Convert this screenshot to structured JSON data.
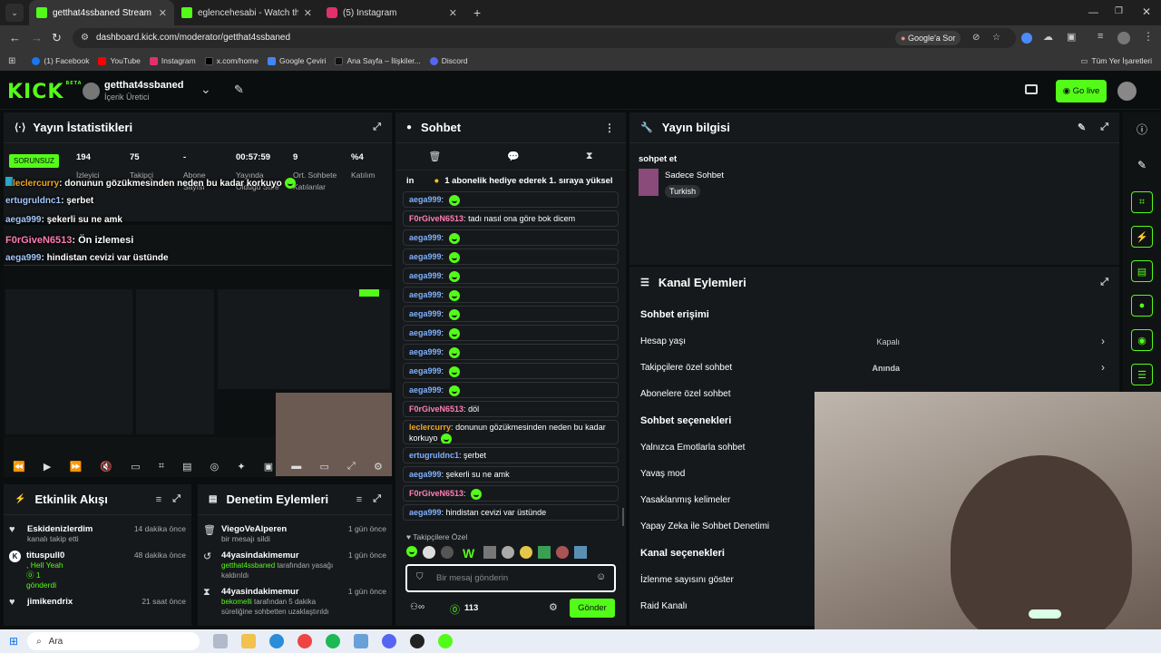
{
  "browser": {
    "tabs": [
      {
        "title": "getthat4ssbaned Stream - Kick",
        "color": "#53fc18"
      },
      {
        "title": "eglencehesabi - Watch the VOD",
        "color": "#53fc18"
      },
      {
        "title": "(5) Instagram",
        "color": "#e1306c"
      }
    ],
    "url": "dashboard.kick.com/moderator/getthat4ssbaned",
    "google_sor": "Google'a Sor",
    "bookmarks": [
      {
        "label": "(1) Facebook",
        "color": "#1877f2"
      },
      {
        "label": "YouTube",
        "color": "#ff0000"
      },
      {
        "label": "Instagram",
        "color": "#e1306c"
      },
      {
        "label": "x.com/home",
        "color": "#000000"
      },
      {
        "label": "Google Çeviri",
        "color": "#4285f4"
      },
      {
        "label": "Ana Sayfa – İlişkiler...",
        "color": "#111111"
      },
      {
        "label": "Discord",
        "color": "#5865f2"
      }
    ],
    "all_bookmarks": "Tüm Yer İşaretleri"
  },
  "header": {
    "logo": "KICK",
    "logo_sup": "BETA",
    "channel_name": "getthat4ssbaned",
    "channel_role": "İçerik Üretici",
    "go_live": "Go live",
    "accent": "#53fc18"
  },
  "stats": {
    "title": "Yayın İstatistikleri",
    "status_badge": "SORUNSUZ",
    "items": [
      {
        "value": "194",
        "label": "İzleyici"
      },
      {
        "value": "75",
        "label": "Takipçi"
      },
      {
        "value": "-",
        "label": "Abone Sayısı"
      },
      {
        "value": "00:57:59",
        "label": "Yayında Olduğu Süre"
      },
      {
        "value": "9",
        "label": "Ort. Sohbete Katılanlar"
      },
      {
        "value": "%4",
        "label": "Katılım"
      }
    ]
  },
  "overlay_chat": [
    {
      "name": "leclercurry",
      "text": ": donunun gözükmesinden neden bu kadar korkuyo",
      "color": "#f5a623"
    },
    {
      "name": "ertugruldnc1",
      "text": ": şerbet",
      "color": "#a6c8ff"
    },
    {
      "name": "aega999",
      "text": ": şekerli su ne amk",
      "color": "#a6c8ff"
    },
    {
      "name": "F0rGiveN6513",
      "text": ": Ön izlemesi",
      "color": "#ff7eb6"
    },
    {
      "name": "aega999",
      "text": ": hindistan cevizi var üstünde",
      "color": "#a6c8ff"
    }
  ],
  "chat": {
    "title": "Sohbet",
    "pinned": "in",
    "pinned_text": "1 abonelik hediye ederek 1. sıraya yüksel",
    "messages": [
      {
        "name": "aega999",
        "text": "",
        "emote": true,
        "color": "#7fb0ff"
      },
      {
        "name": "F0rGiveN6513",
        "text": "tadı nasıl ona göre bok dicem",
        "emote": false,
        "color": "#ff7eb6"
      },
      {
        "name": "aega999",
        "text": "",
        "emote": true,
        "color": "#7fb0ff"
      },
      {
        "name": "aega999",
        "text": "",
        "emote": true,
        "color": "#7fb0ff"
      },
      {
        "name": "aega999",
        "text": "",
        "emote": true,
        "color": "#7fb0ff"
      },
      {
        "name": "aega999",
        "text": "",
        "emote": true,
        "color": "#7fb0ff"
      },
      {
        "name": "aega999",
        "text": "",
        "emote": true,
        "color": "#7fb0ff"
      },
      {
        "name": "aega999",
        "text": "",
        "emote": true,
        "color": "#7fb0ff"
      },
      {
        "name": "aega999",
        "text": "",
        "emote": true,
        "color": "#7fb0ff"
      },
      {
        "name": "aega999",
        "text": "",
        "emote": true,
        "color": "#7fb0ff"
      },
      {
        "name": "aega999",
        "text": "",
        "emote": true,
        "color": "#7fb0ff"
      },
      {
        "name": "F0rGiveN6513",
        "text": "döl",
        "emote": false,
        "color": "#ff7eb6"
      },
      {
        "name": "leclercurry",
        "text": "donunun gözükmesinden neden bu kadar korkuyo",
        "emote": true,
        "color": "#f5a623",
        "double": true
      },
      {
        "name": "ertugruldnc1",
        "text": "şerbet",
        "emote": false,
        "color": "#7fb0ff"
      },
      {
        "name": "aega999",
        "text": "şekerli su ne amk",
        "emote": false,
        "color": "#7fb0ff"
      },
      {
        "name": "F0rGiveN6513",
        "text": "",
        "emote": true,
        "color": "#ff7eb6"
      },
      {
        "name": "aega999",
        "text": "hindistan cevizi var üstünde",
        "emote": false,
        "color": "#7fb0ff"
      }
    ],
    "followers_only": "Takipçilere Özel",
    "input_placeholder": "Bir mesaj gönderin",
    "points": "113",
    "send_label": "Gönder"
  },
  "stream_info": {
    "title": "Yayın bilgisi",
    "stream_title": "sohpet et",
    "category": "Sadece Sohbet",
    "language": "Turkish"
  },
  "channel_actions": {
    "title": "Kanal Eylemleri",
    "chat_access": "Sohbet erişimi",
    "rows1": [
      {
        "label": "Hesap yaşı",
        "value": "Kapalı"
      },
      {
        "label": "Takipçilere özel sohbet",
        "value": "Anında"
      },
      {
        "label": "Abonelere özel sohbet",
        "value": ""
      }
    ],
    "chat_options": "Sohbet seçenekleri",
    "rows2": [
      {
        "label": "Yalnızca Emotlarla sohbet"
      },
      {
        "label": "Yavaş mod"
      },
      {
        "label": "Yasaklanmış kelimeler"
      },
      {
        "label": "Yapay Zeka ile Sohbet Denetimi"
      }
    ],
    "channel_options": "Kanal seçenekleri",
    "rows3": [
      {
        "label": "İzlenme sayısını göster"
      },
      {
        "label": "Raid Kanalı"
      }
    ]
  },
  "activity": {
    "title": "Etkinlik Akışı",
    "items": [
      {
        "name": "Eskidenizlerdim",
        "sub": "kanalı takip etti",
        "time": "14 dakika önce",
        "icon": "heart-icon"
      },
      {
        "name": "tituspull0",
        "sub": ", Hell Yeah",
        "sub2": "1",
        "sub3": "gönderdi",
        "time": "48 dakika önce",
        "icon": "kick-icon"
      },
      {
        "name": "jimikendrix",
        "sub": "",
        "time": "21 saat önce",
        "icon": "heart-icon"
      }
    ]
  },
  "moderation": {
    "title": "Denetim Eylemleri",
    "items": [
      {
        "name": "ViegoVeAlperen",
        "sub": "bir mesajı sildi",
        "time": "1 gün önce",
        "icon": "trash-icon"
      },
      {
        "name": "44yasindakimemur",
        "sub_green": "getthat4ssbaned",
        "sub": " tarafından yasağı kaldırıldı",
        "time": "1 gün önce",
        "icon": "undo-icon"
      },
      {
        "name": "44yasindakimemur",
        "sub_green": "bekomelli",
        "sub": " tarafından 5 dakika süreliğine sohbetten uzaklaştırıldı",
        "time": "1 gün önce",
        "icon": "hourglass-icon"
      }
    ]
  },
  "taskbar": {
    "search_placeholder": "Ara"
  }
}
